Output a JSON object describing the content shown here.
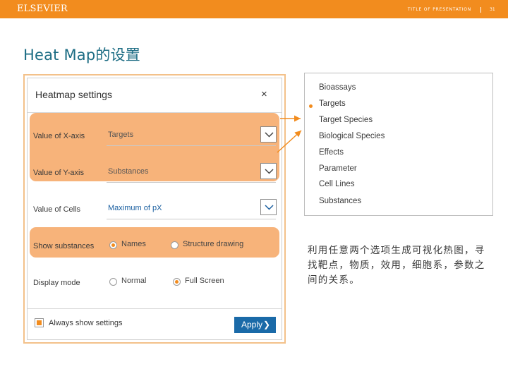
{
  "header": {
    "logo": "ELSEVIER",
    "presentation_title": "TITLE OF PRESENTATION",
    "page_number": "31"
  },
  "slide": {
    "title": "Heat  Map的设置",
    "note": "利用任意两个选项生成可视化热图，寻找靶点，物质，效用，细胞系，参数之间的关系。"
  },
  "dialog": {
    "title": "Heatmap settings",
    "close_icon": "×",
    "x_axis": {
      "label": "Value of X-axis",
      "value": "Targets"
    },
    "y_axis": {
      "label": "Value of Y-axis",
      "value": "Substances"
    },
    "cells": {
      "label": "Value of Cells",
      "value": "Maximum of pX"
    },
    "show_substances": {
      "label": "Show substances",
      "options": [
        "Names",
        "Structure drawing"
      ],
      "selected": "Names"
    },
    "display_mode": {
      "label": "Display mode",
      "options": [
        "Normal",
        "Full Screen"
      ],
      "selected": "Full Screen"
    },
    "always_show": {
      "label": "Always show settings",
      "checked": true
    },
    "apply_label": "Apply",
    "apply_chevron": "❯"
  },
  "option_list": {
    "items": [
      "Bioassays",
      "Targets",
      "Target Species",
      "Biological Species",
      "Effects",
      "Parameter",
      "Cell Lines",
      "Substances"
    ],
    "selected": "Targets"
  },
  "colors": {
    "brand": "#f28c1e",
    "highlight": "#f7b37a",
    "apply_button": "#1a6aa8",
    "title_text": "#1d6d84"
  }
}
